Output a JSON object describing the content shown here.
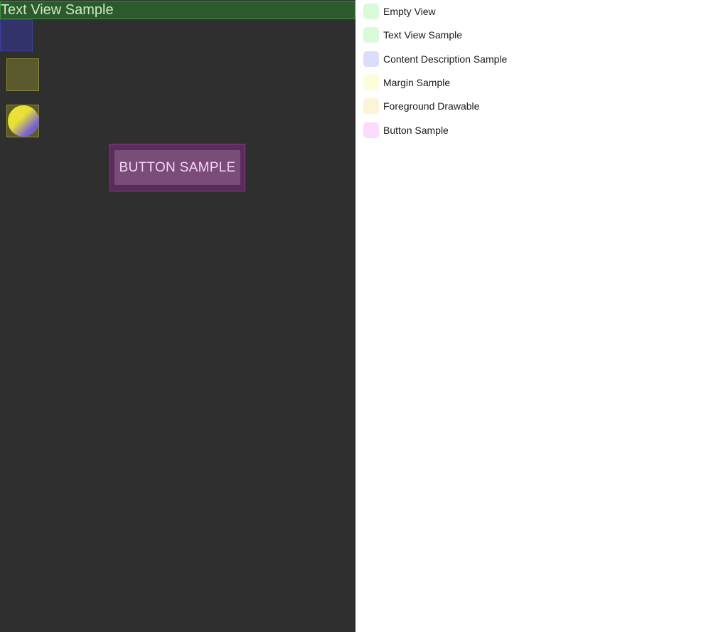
{
  "preview": {
    "text_view": "Text View Sample",
    "button": "BUTTON SAMPLE",
    "foreground_icon": "gradient-circle-icon"
  },
  "legend": {
    "items": [
      {
        "label": "Empty View",
        "color": "#d9fbd9"
      },
      {
        "label": "Text View Sample",
        "color": "#d9fbd9"
      },
      {
        "label": "Content Description Sample",
        "color": "#dcdcfc"
      },
      {
        "label": "Margin Sample",
        "color": "#fdfdd9"
      },
      {
        "label": "Foreground Drawable",
        "color": "#fdf3d9"
      },
      {
        "label": "Button Sample",
        "color": "#fcdcfc"
      }
    ]
  }
}
